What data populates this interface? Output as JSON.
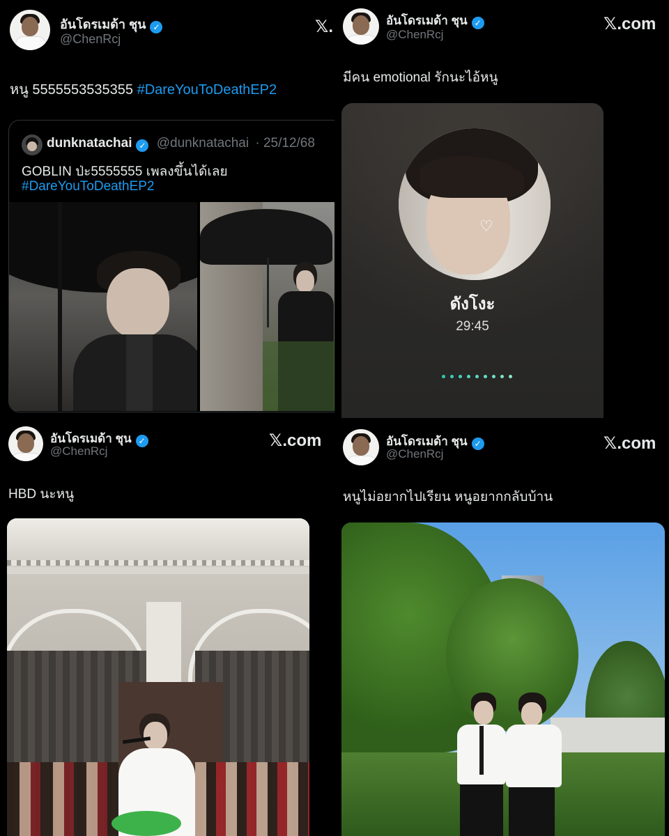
{
  "panels": [
    {
      "display_name": "อันโดรเมด้า ชุน",
      "handle": "@ChenRcj",
      "x_logo": "𝕏.",
      "text": "หนู  5555553535355 ",
      "hashtag": "#DareYouToDeathEP2",
      "quote": {
        "display_name": "dunknatachai",
        "handle": "@dunknatachai",
        "date": "· 25/12/68",
        "text": "GOBLIN ป่ะ5555555 เพลงขึ้นได้เลย",
        "hashtag": "#DareYouToDeathEP2"
      }
    },
    {
      "display_name": "อันโดรเมด้า ชุน",
      "handle": "@ChenRcj",
      "x_logo": "𝕏.com",
      "text": "มีคน emotional รักนะไอ้หนู",
      "call": {
        "name": "ดังโงะ",
        "duration": "29:45"
      }
    },
    {
      "display_name": "อันโดรเมด้า ชุน",
      "handle": "@ChenRcj",
      "x_logo": "𝕏.com",
      "text": "HBD นะหนู"
    },
    {
      "display_name": "อันโดรเมด้า ชุน",
      "handle": "@ChenRcj",
      "x_logo": "𝕏.com",
      "text": "หนูไม่อยากไปเรียน หนูอยากกลับบ้าน"
    }
  ],
  "verified_glyph": "✓",
  "colors": {
    "accent": "#1d9bf0",
    "bg": "#000000",
    "text": "#e7e9ea",
    "muted": "#71767b"
  }
}
